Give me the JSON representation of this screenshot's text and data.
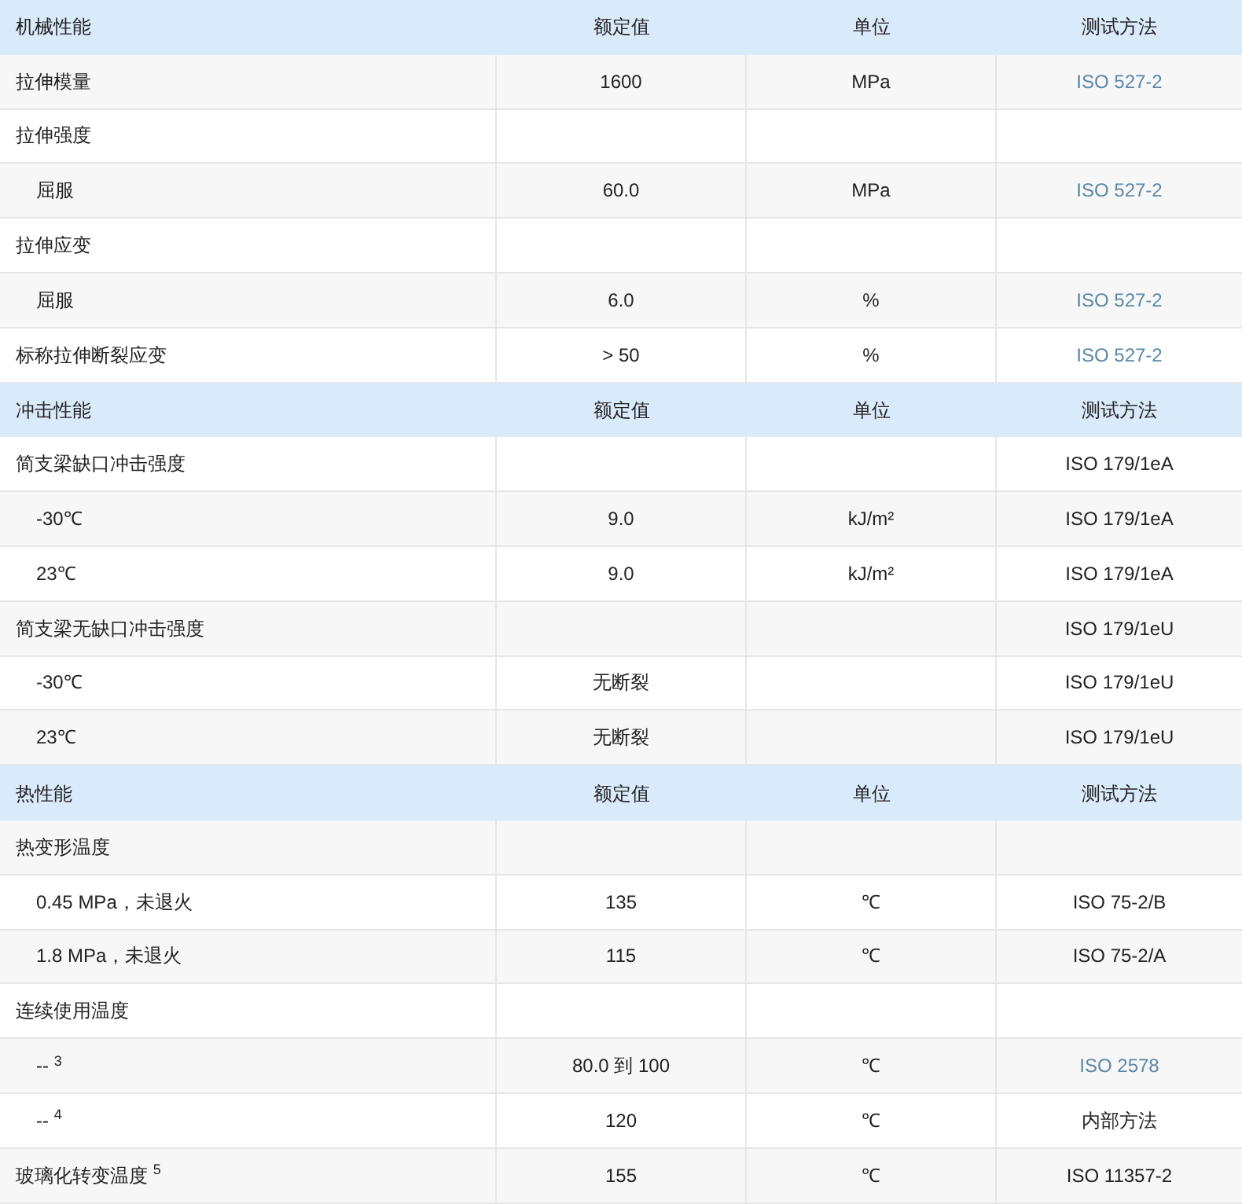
{
  "sections": [
    {
      "header": [
        "机械性能",
        "额定值",
        "单位",
        "测试方法"
      ],
      "rows": [
        {
          "label": "拉伸模量",
          "value": "1600",
          "unit": "MPa",
          "method": "ISO 527-2",
          "method_link": true
        },
        {
          "label": "拉伸强度",
          "children": [
            {
              "label": "屈服",
              "value": "60.0",
              "unit": "MPa",
              "method": "ISO 527-2",
              "method_link": true
            }
          ]
        },
        {
          "label": "拉伸应变",
          "children": [
            {
              "label": "屈服",
              "value": "6.0",
              "unit": "%",
              "method": "ISO 527-2",
              "method_link": true
            }
          ]
        },
        {
          "label": "标称拉伸断裂应变",
          "value": "> 50",
          "unit": "%",
          "method": "ISO 527-2",
          "method_link": true
        }
      ]
    },
    {
      "header": [
        "冲击性能",
        "额定值",
        "单位",
        "测试方法"
      ],
      "rows": [
        {
          "label": "简支梁缺口冲击强度",
          "method": "ISO 179/1eA",
          "method_link": false,
          "children": [
            {
              "label": "-30℃",
              "value": "9.0",
              "unit": "kJ/m²",
              "method": "ISO 179/1eA",
              "method_link": false
            },
            {
              "label": "23℃",
              "value": "9.0",
              "unit": "kJ/m²",
              "method": "ISO 179/1eA",
              "method_link": false
            }
          ]
        },
        {
          "label": "简支梁无缺口冲击强度",
          "method": "ISO 179/1eU",
          "method_link": false,
          "children": [
            {
              "label": "-30℃",
              "value": "无断裂",
              "method": "ISO 179/1eU",
              "method_link": false
            },
            {
              "label": "23℃",
              "value": "无断裂",
              "method": "ISO 179/1eU",
              "method_link": false
            }
          ]
        }
      ]
    },
    {
      "header": [
        "热性能",
        "额定值",
        "单位",
        "测试方法"
      ],
      "rows": [
        {
          "label": "热变形温度",
          "children": [
            {
              "label": "0.45 MPa，未退火",
              "value": "135",
              "unit": "℃",
              "method": "ISO 75-2/B",
              "method_link": false
            },
            {
              "label": "1.8 MPa，未退火",
              "value": "115",
              "unit": "℃",
              "method": "ISO 75-2/A",
              "method_link": false
            }
          ]
        },
        {
          "label": "连续使用温度",
          "children": [
            {
              "label": "-- $^{3}$",
              "value": "80.0 到 100",
              "unit": "℃",
              "method": "ISO 2578",
              "method_link": true
            },
            {
              "label": "-- $^{4}$",
              "value": "120",
              "unit": "℃",
              "method": "内部方法",
              "method_link": false
            }
          ]
        },
        {
          "label": "玻璃化转变温度 $^{5}$",
          "value": "155",
          "unit": "℃",
          "method": "ISO 11357-2",
          "method_link": false
        }
      ]
    }
  ]
}
